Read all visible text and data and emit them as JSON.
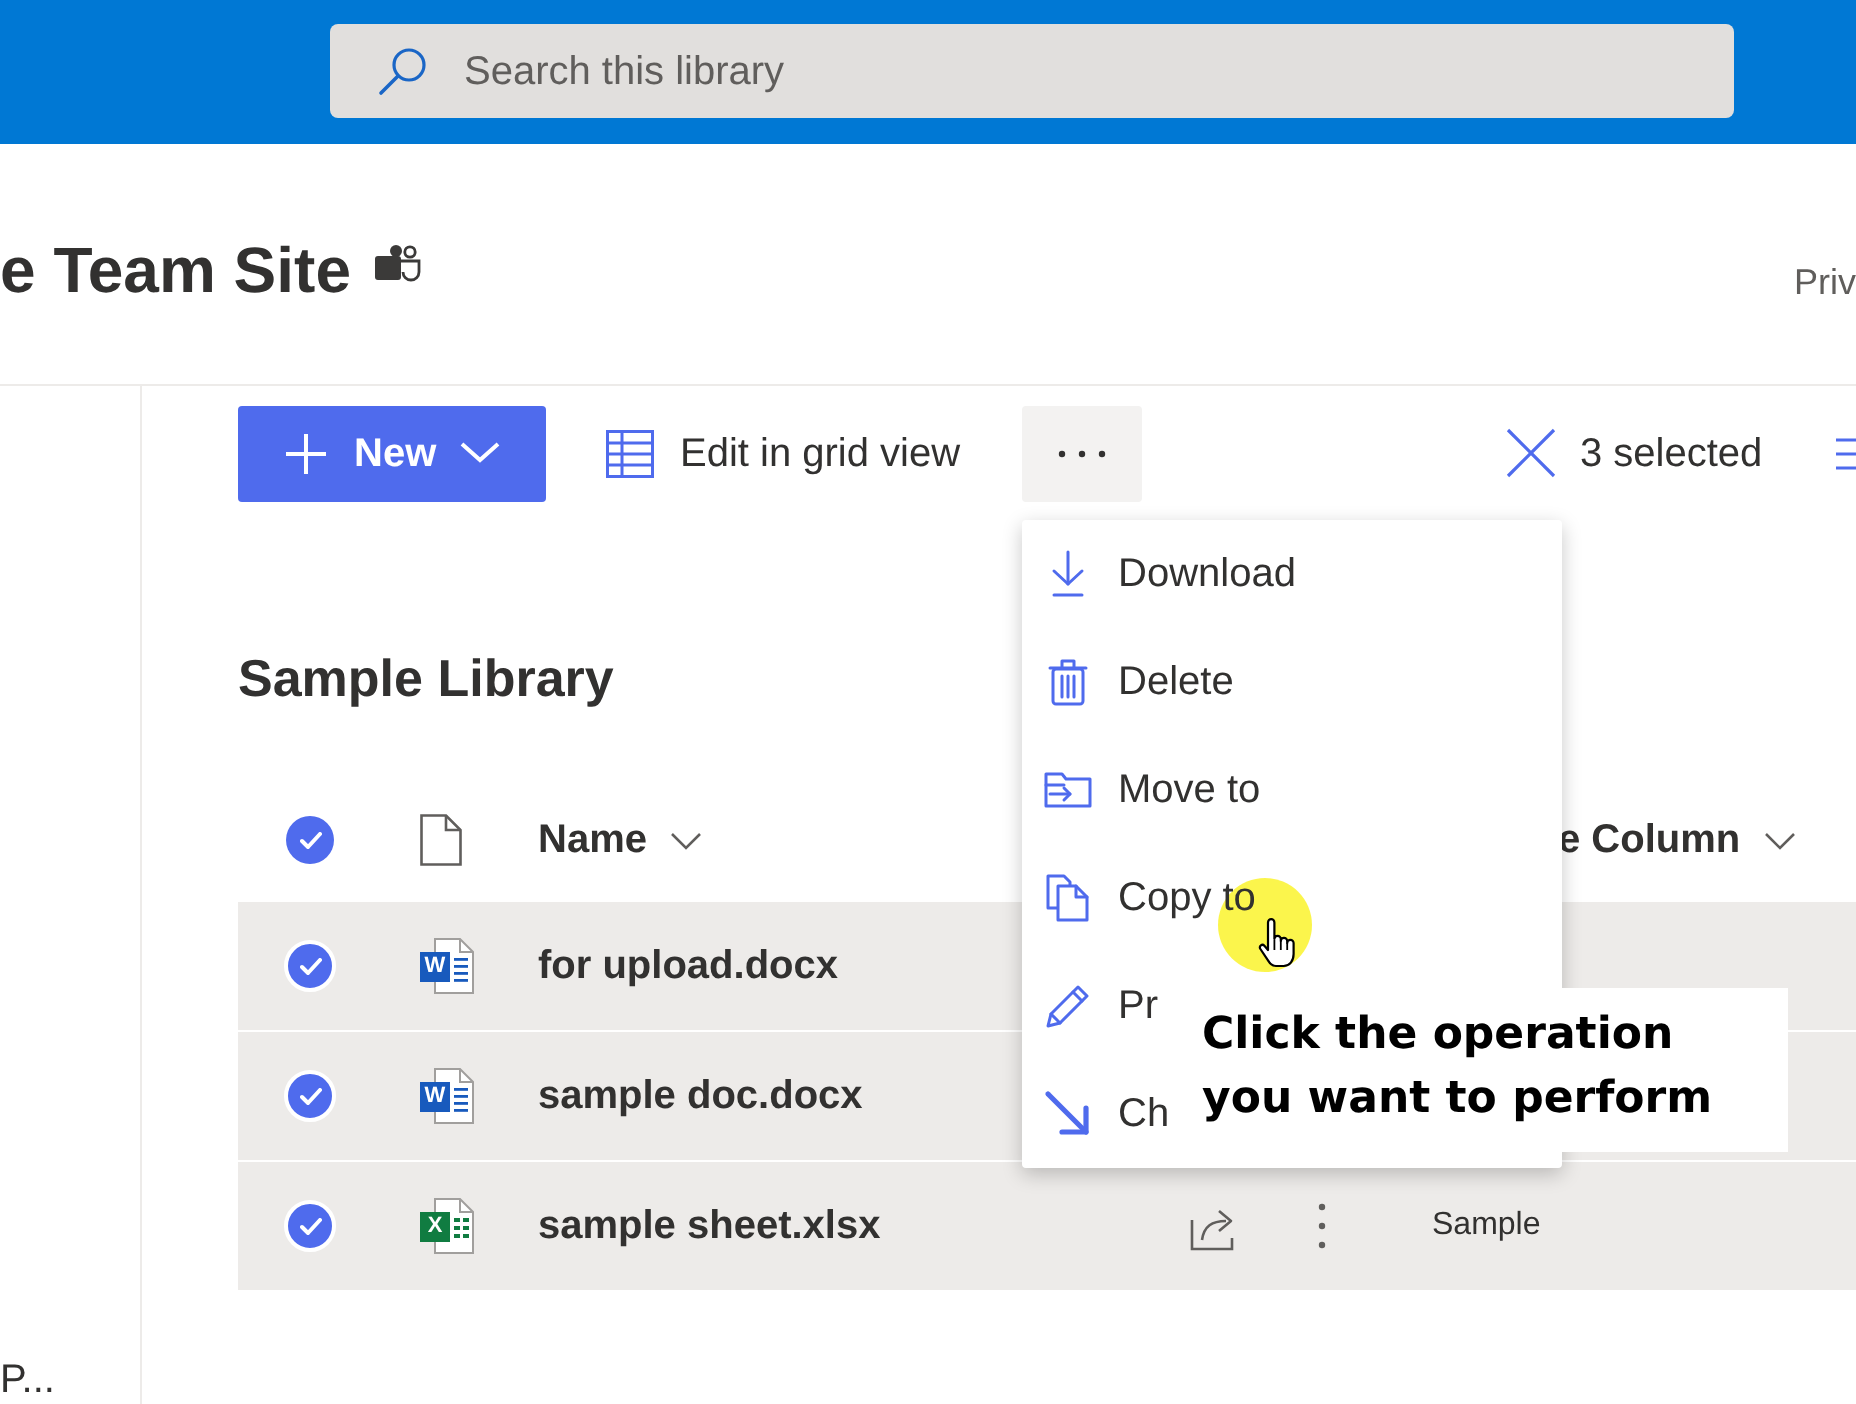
{
  "top_bar": {
    "search": {
      "placeholder": "Search this library"
    }
  },
  "site_header": {
    "title": "e Team Site",
    "privacy": "Priv"
  },
  "left_nav": {
    "text": "P..."
  },
  "command_bar": {
    "new_button": {
      "label": "New"
    },
    "grid_button": {
      "label": "Edit in grid view"
    },
    "selection": {
      "label": "3 selected"
    }
  },
  "library": {
    "title": "Sample Library",
    "select_all": {
      "selected": true
    },
    "columns": [
      {
        "label": "Name"
      },
      {
        "label": "e Column"
      }
    ],
    "rows": [
      {
        "name": "for upload.docx",
        "kind": "word",
        "icon_letter": "W",
        "selected": true
      },
      {
        "name": "sample doc.docx",
        "kind": "word",
        "icon_letter": "W",
        "selected": true
      },
      {
        "name": "sample sheet.xlsx",
        "kind": "excel",
        "icon_letter": "X",
        "selected": true,
        "actions_shown": true,
        "column_3": "Sample"
      }
    ]
  },
  "more_menu": {
    "items": [
      {
        "kind": "download",
        "label": "Download"
      },
      {
        "kind": "trash",
        "label": "Delete"
      },
      {
        "kind": "folder_arrow",
        "label": "Move to"
      },
      {
        "kind": "copy",
        "label": "Copy to"
      },
      {
        "kind": "pencil",
        "label": "Pr"
      },
      {
        "kind": "diagonal_arrow",
        "label": "Ch"
      }
    ]
  },
  "callout": {
    "text": "Click the operation you want to perform"
  }
}
